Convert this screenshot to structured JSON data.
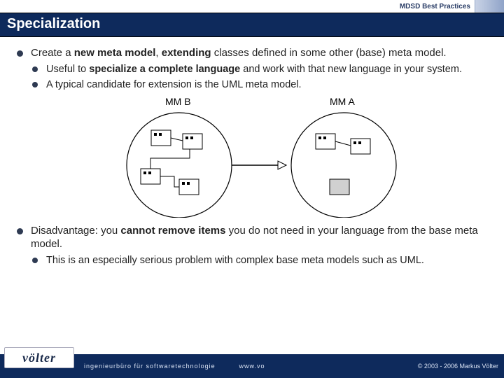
{
  "header": {
    "topLabel": "MDSD Best Practices",
    "title": "Specialization"
  },
  "bullets": {
    "b1a": "Create a ",
    "b1b": "new meta model",
    "b1c": ", ",
    "b1d": "extending",
    "b1e": " classes defined in some other (base) meta model.",
    "b1_1a": "Useful to ",
    "b1_1b": "specialize a complete language",
    "b1_1c": " and work with that new language in your system.",
    "b1_2": "A typical candidate for extension is the UML meta model.",
    "b2a": "Disadvantage: you ",
    "b2b": "cannot remove items",
    "b2c": " you do not need in your language from the base meta model.",
    "b2_1": "This is an especially serious problem with complex base meta models such as UML."
  },
  "diagram": {
    "leftLabel": "MM B",
    "rightLabel": "MM A"
  },
  "footer": {
    "logo": "völter",
    "tagline": "ingenieurbüro für softwaretechnologie",
    "website": "www.vo",
    "copyright": "© 2003 - 2006 Markus Völter"
  }
}
